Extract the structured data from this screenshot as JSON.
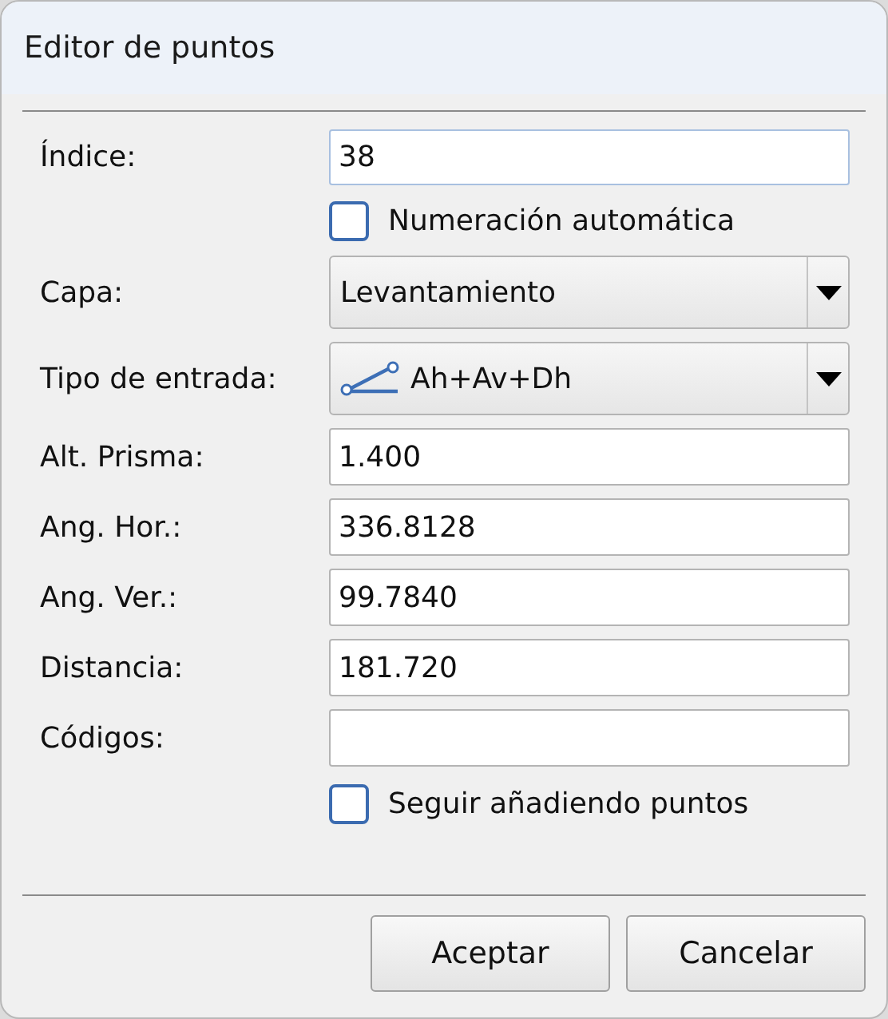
{
  "window": {
    "title": "Editor de puntos"
  },
  "fields": [
    {
      "kind": "text",
      "label": "Índice:",
      "value": "38",
      "focused": true
    },
    {
      "kind": "checkbox",
      "label": "Numeración automática",
      "checked": false
    },
    {
      "kind": "select",
      "label": "Capa:",
      "value": "Levantamiento",
      "has_icon": false
    },
    {
      "kind": "select",
      "label": "Tipo de entrada:",
      "value": "Ah+Av+Dh",
      "has_icon": true
    },
    {
      "kind": "text",
      "label": "Alt. Prisma:",
      "value": "1.400",
      "focused": false
    },
    {
      "kind": "text",
      "label": "Ang. Hor.:",
      "value": "336.8128",
      "focused": false
    },
    {
      "kind": "text",
      "label": "Ang. Ver.:",
      "value": "99.7840",
      "focused": false
    },
    {
      "kind": "text",
      "label": "Distancia:",
      "value": "181.720",
      "focused": false
    },
    {
      "kind": "text",
      "label": "Códigos:",
      "focused": false
    },
    {
      "kind": "checkbox",
      "label": "Seguir añadiendo puntos",
      "checked": false
    }
  ],
  "buttons": [
    "Aceptar",
    "Cancelar"
  ]
}
